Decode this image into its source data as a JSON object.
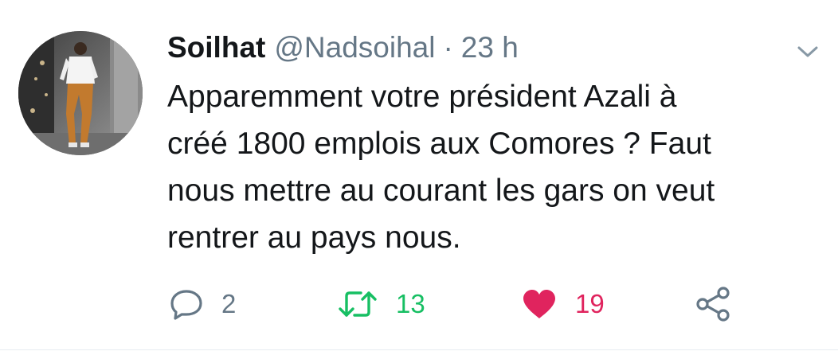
{
  "tweet": {
    "author": {
      "name": "Soilhat",
      "handle": "@Nadsoihal"
    },
    "separator": "·",
    "time": "23 h",
    "text": "Apparemment votre président Azali à\ncréé 1800 emplois aux Comores ?   Faut\nnous mettre au courant les gars on veut\nrentrer au pays nous.",
    "stats": {
      "replies": "2",
      "retweets": "13",
      "likes": "19"
    },
    "liked": true
  },
  "colors": {
    "text": "#14171a",
    "muted": "#657786",
    "retweet": "#17bf63",
    "like": "#e0245e",
    "divider": "#e6ecf0"
  },
  "icons": {
    "reply": "reply-icon",
    "retweet": "retweet-icon",
    "like": "heart-icon",
    "share": "share-icon",
    "menu": "chevron-down-icon"
  }
}
